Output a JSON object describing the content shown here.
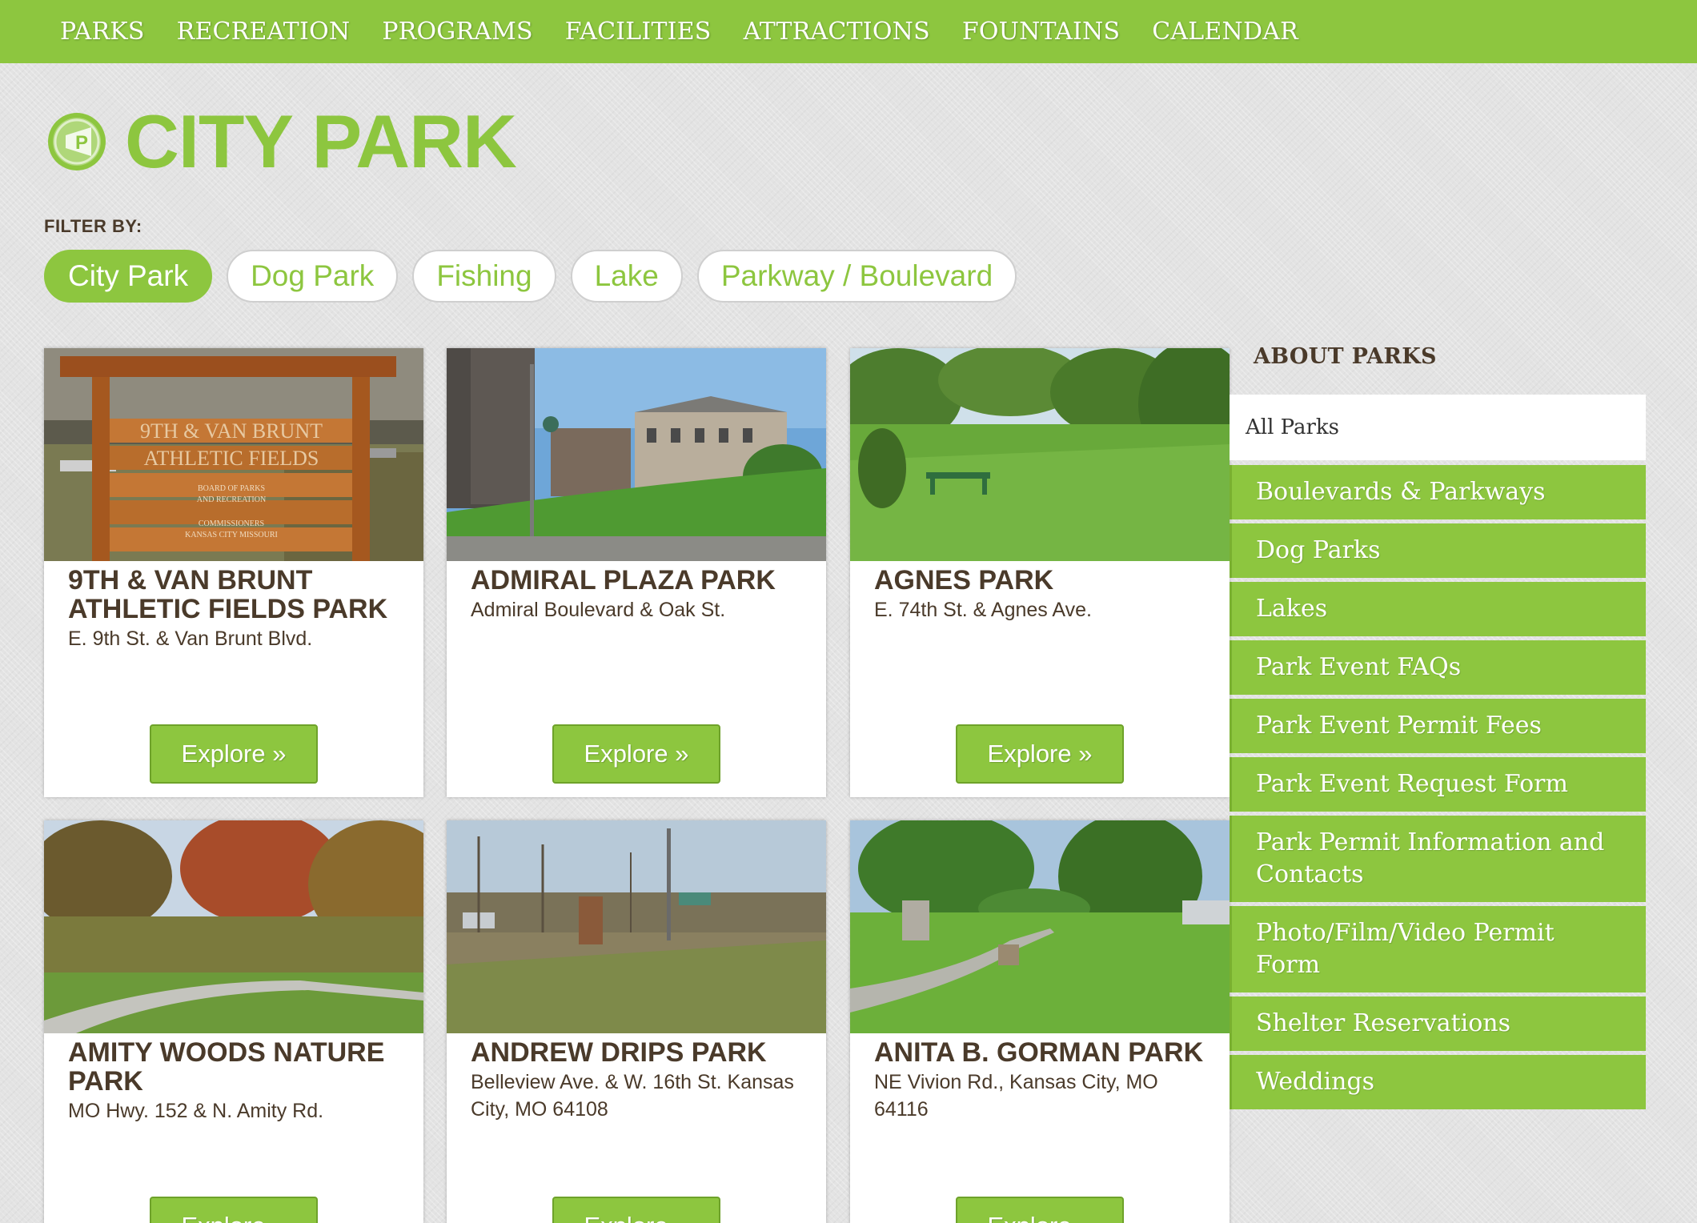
{
  "nav": [
    "PARKS",
    "RECREATION",
    "PROGRAMS",
    "FACILITIES",
    "ATTRACTIONS",
    "FOUNTAINS",
    "CALENDAR"
  ],
  "page_title": "CITY PARK",
  "filter_label": "FILTER BY:",
  "filters": [
    {
      "label": "City Park",
      "active": true
    },
    {
      "label": "Dog Park",
      "active": false
    },
    {
      "label": "Fishing",
      "active": false
    },
    {
      "label": "Lake",
      "active": false
    },
    {
      "label": "Parkway / Boulevard",
      "active": false
    }
  ],
  "parks": [
    {
      "name": "9TH & VAN BRUNT ATHLETIC FIELDS PARK",
      "address": "E. 9th St. & Van Brunt Blvd.",
      "button": "Explore »",
      "sign_text": [
        "9TH & VAN BRUNT",
        "ATHLETIC FIELDS",
        "BOARD OF PARKS",
        "AND RECREATION",
        "COMMISSIONERS",
        "KANSAS CITY MISSOURI"
      ]
    },
    {
      "name": "ADMIRAL PLAZA PARK",
      "address": "Admiral Boulevard & Oak St.",
      "button": "Explore »"
    },
    {
      "name": "AGNES PARK",
      "address": "E. 74th St. & Agnes Ave.",
      "button": "Explore »"
    },
    {
      "name": "AMITY WOODS NATURE PARK",
      "address": "MO Hwy. 152 & N. Amity Rd.",
      "button": "Explore »"
    },
    {
      "name": "ANDREW DRIPS PARK",
      "address": "Belleview Ave. & W. 16th St. Kansas City, MO 64108",
      "button": "Explore »"
    },
    {
      "name": "ANITA B. GORMAN PARK",
      "address": "NE Vivion Rd., Kansas City, MO 64116",
      "button": "Explore »"
    }
  ],
  "sidebar": {
    "heading": "ABOUT PARKS",
    "all": "All Parks",
    "items": [
      "Boulevards & Parkways",
      "Dog Parks",
      "Lakes",
      "Park Event FAQs",
      "Park Event Permit Fees",
      "Park Event Request Form",
      "Park Permit Information and Contacts",
      "Photo/Film/Video Permit Form",
      "Shelter Reservations",
      "Weddings"
    ]
  },
  "colors": {
    "brand_green": "#8dc63f",
    "text_brown": "#4a3a2a",
    "background": "#e3e3e3"
  },
  "icons": {
    "title": "parks-logo-icon"
  }
}
